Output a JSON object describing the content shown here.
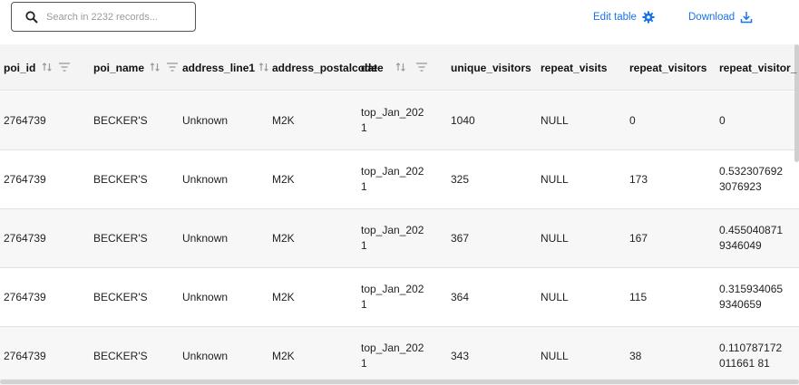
{
  "search": {
    "placeholder": "Search in 2232 records..."
  },
  "toolbar": {
    "edit_table_label": "Edit table",
    "download_label": "Download"
  },
  "colors": {
    "accent": "#1a73e8",
    "header_bg": "#f4f4f4",
    "alt_row_bg": "#f7f7f7"
  },
  "icons": {
    "search": "search-icon",
    "edit": "gear-icon",
    "download": "download-icon",
    "sort": "sort-icon",
    "filter": "filter-icon"
  },
  "table": {
    "columns": [
      {
        "key": "poi_id",
        "label": "poi_id"
      },
      {
        "key": "poi_name",
        "label": "poi_name"
      },
      {
        "key": "address_line1",
        "label": "address_line1"
      },
      {
        "key": "address_postalcode",
        "label": "address_postalcode"
      },
      {
        "key": "date",
        "label": "date"
      },
      {
        "key": "unique_visitors",
        "label": "unique_visitors"
      },
      {
        "key": "repeat_visits",
        "label": "repeat_visits"
      },
      {
        "key": "repeat_visitors",
        "label": "repeat_visitors"
      },
      {
        "key": "repeat_visitor_ratio",
        "label": "repeat_visitor_"
      }
    ],
    "rows": [
      [
        "2764739",
        "BECKER'S",
        "Unknown",
        "M2K",
        "top_Jan_2021",
        "1040",
        "NULL",
        "0",
        "0"
      ],
      [
        "2764739",
        "BECKER'S",
        "Unknown",
        "M2K",
        "top_Jan_2021",
        "325",
        "NULL",
        "173",
        "0.5323076923076923"
      ],
      [
        "2764739",
        "BECKER'S",
        "Unknown",
        "M2K",
        "top_Jan_2021",
        "367",
        "NULL",
        "167",
        "0.4550408719346049"
      ],
      [
        "2764739",
        "BECKER'S",
        "Unknown",
        "M2K",
        "top_Jan_2021",
        "364",
        "NULL",
        "115",
        "0.3159340659340659"
      ],
      [
        "2764739",
        "BECKER'S",
        "Unknown",
        "M2K",
        "top_Jan_2021",
        "343",
        "NULL",
        "38",
        "0.110787172011661 81"
      ]
    ]
  }
}
